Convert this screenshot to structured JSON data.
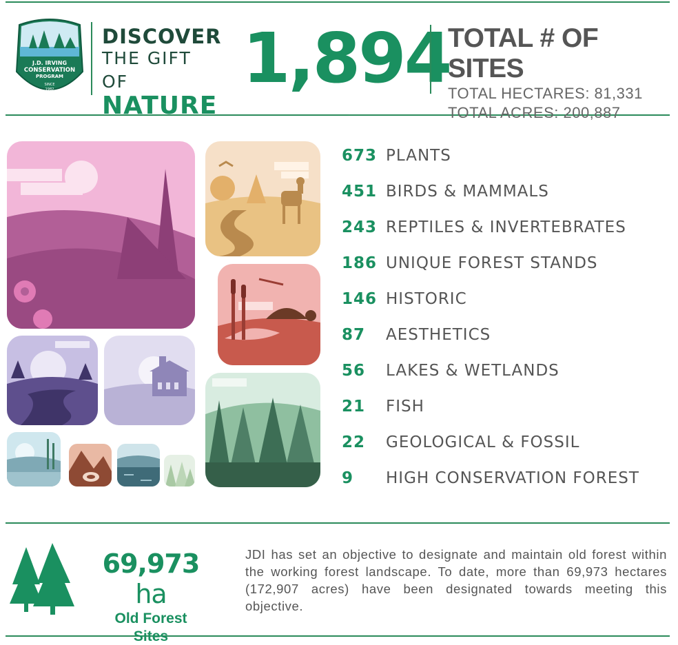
{
  "logo": {
    "line1": "J.D. IRVING",
    "line2": "CONSERVATION",
    "line3": "PROGRAM",
    "since": "SINCE",
    "year": "1982"
  },
  "headline": {
    "line1": "DISCOVER",
    "line2": "THE GIFT OF",
    "line3": "NATURE"
  },
  "total_sites": "1,894",
  "totals": {
    "title": "TOTAL # OF SITES",
    "hectares": "TOTAL HECTARES: 81,331",
    "acres": "TOTAL ACRES: 200,887"
  },
  "categories": [
    {
      "count": "673",
      "label": "PLANTS"
    },
    {
      "count": "451",
      "label": "BIRDS & MAMMALS"
    },
    {
      "count": "243",
      "label": "REPTILES & INVERTEBRATES"
    },
    {
      "count": "186",
      "label": "UNIQUE FOREST STANDS"
    },
    {
      "count": "146",
      "label": "HISTORIC"
    },
    {
      "count": "87",
      "label": "AESTHETICS"
    },
    {
      "count": "56",
      "label": "LAKES & WETLANDS"
    },
    {
      "count": "21",
      "label": "FISH"
    },
    {
      "count": "22",
      "label": "GEOLOGICAL & FOSSIL"
    },
    {
      "count": "9",
      "label": "HIGH CONSERVATION FOREST"
    }
  ],
  "old_forest": {
    "value": "69,973",
    "unit": "ha",
    "caption_line1": "Old Forest",
    "caption_line2": "Sites",
    "description": "JDI has set an objective to designate and maintain old forest within the working forest landscape. To date, more than 69,973 hectares (172,907 acres) have been designated towards meeting this objective."
  },
  "colors": {
    "accent_green": "#1a9060",
    "rule_green": "#2a8a5a",
    "text_gray": "#555555"
  },
  "icons": [
    "conservation-program-logo",
    "plants-tile",
    "birds-mammals-tile",
    "reptiles-invertebrates-tile",
    "aesthetics-tile",
    "historic-tile",
    "forest-tile",
    "wetlands-tile",
    "geological-tile",
    "fish-tile",
    "small-forest-tile",
    "old-forest-trees-icon"
  ]
}
